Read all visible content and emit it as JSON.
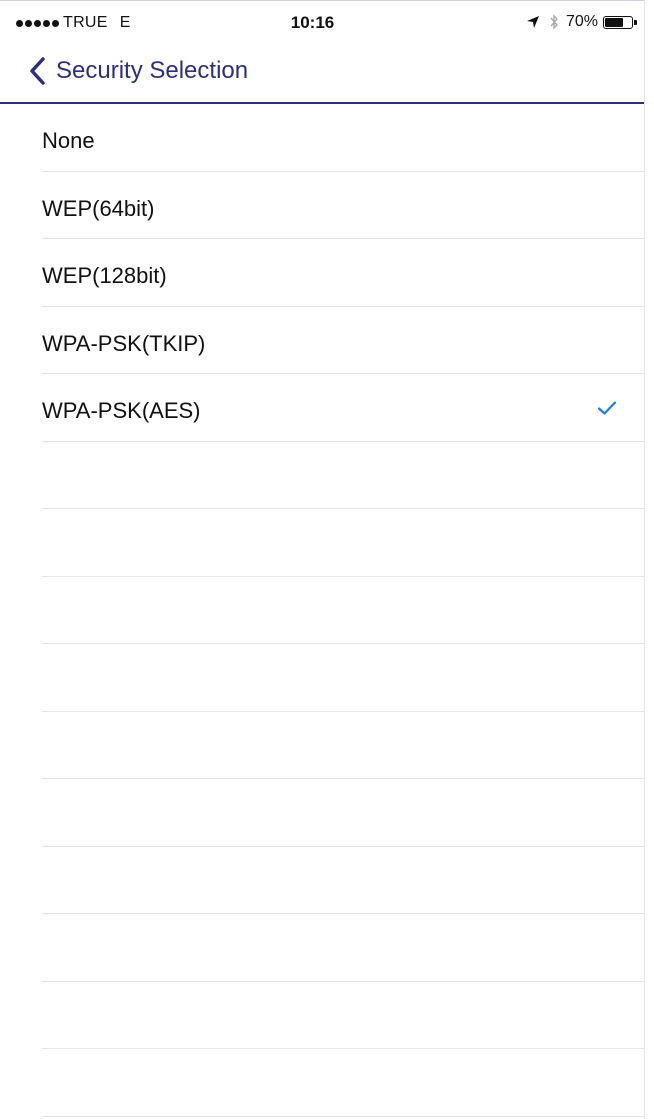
{
  "status_bar": {
    "carrier": "TRUE",
    "network": "E",
    "time": "10:16",
    "battery_text": "70%",
    "battery_level": 0.7,
    "signal_bars": 5,
    "icons": [
      "signal-dots-icon",
      "location-arrow-icon",
      "bluetooth-icon",
      "battery-icon"
    ]
  },
  "nav": {
    "back_label": "Security Selection",
    "back_icon": "chevron-left-icon",
    "accent_color": "#2b2f7d"
  },
  "options": [
    {
      "label": "None",
      "selected": false
    },
    {
      "label": "WEP(64bit)",
      "selected": false
    },
    {
      "label": "WEP(128bit)",
      "selected": false
    },
    {
      "label": "WPA-PSK(TKIP)",
      "selected": false
    },
    {
      "label": "WPA-PSK(AES)",
      "selected": true
    }
  ],
  "check_icon": "checkmark-icon",
  "check_color": "#1a7de8",
  "empty_rows": 10
}
